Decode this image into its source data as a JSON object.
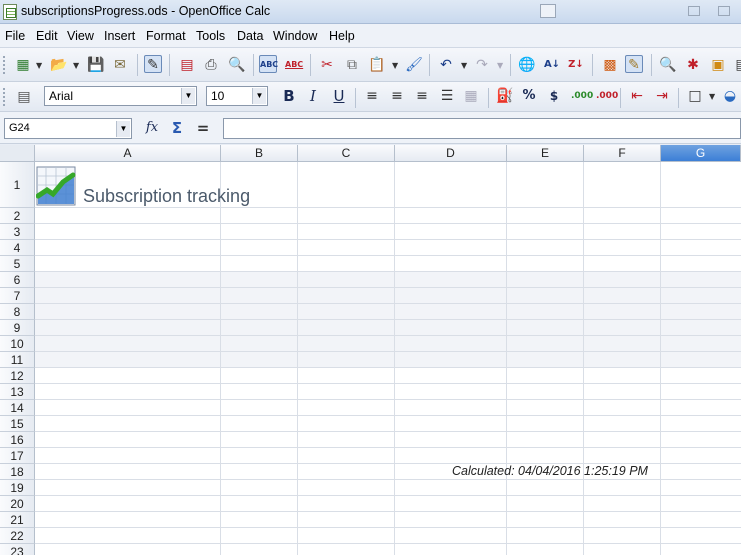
{
  "window": {
    "title": "subscriptionsProgress.ods - OpenOffice Calc"
  },
  "menu": [
    "File",
    "Edit",
    "View",
    "Insert",
    "Format",
    "Tools",
    "Data",
    "Window",
    "Help"
  ],
  "toolbar_standard": {
    "icons": [
      "new-document-icon",
      "open-icon",
      "save-icon",
      "email-icon",
      "edit-file-icon",
      "export-pdf-icon",
      "print-icon",
      "page-preview-icon",
      "spellcheck-icon",
      "autospellcheck-icon",
      "cut-icon",
      "copy-icon",
      "paste-icon",
      "clone-format-icon",
      "undo-icon",
      "redo-icon",
      "hyperlink-icon",
      "sort-ascending-icon",
      "sort-descending-icon",
      "chart-icon",
      "show-draw-functions-icon",
      "find-icon",
      "navigator-icon",
      "gallery-icon",
      "data-sources-icon"
    ]
  },
  "toolbar_format": {
    "font_name": "Arial",
    "font_size": "10",
    "bold": "B",
    "italic": "I",
    "underline": "U",
    "percent": "%",
    "currency": "$"
  },
  "formula_bar": {
    "cell_reference": "G24",
    "formula": ""
  },
  "columns": [
    {
      "label": "A",
      "selected": false
    },
    {
      "label": "B",
      "selected": false
    },
    {
      "label": "C",
      "selected": false
    },
    {
      "label": "D",
      "selected": false
    },
    {
      "label": "E",
      "selected": false
    },
    {
      "label": "F",
      "selected": false
    },
    {
      "label": "G",
      "selected": true
    }
  ],
  "rows": [
    "1",
    "2",
    "3",
    "4",
    "5",
    "6",
    "7",
    "8",
    "9",
    "10",
    "11",
    "12",
    "13",
    "14",
    "15",
    "16",
    "17",
    "18",
    "19",
    "20",
    "21",
    "22",
    "23"
  ],
  "cells": {
    "title": "Subscription tracking",
    "calculated": "Calculated: 04/04/2016 1:25:19 PM"
  },
  "colors": {
    "selected_header": "#3c7fd6",
    "title_text": "#4b5a6b",
    "shaded_rows": "#f2f4f8"
  }
}
